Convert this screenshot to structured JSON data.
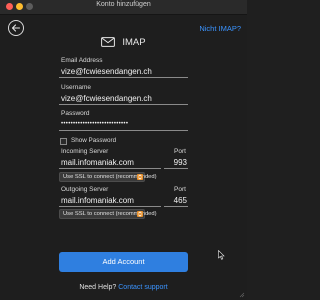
{
  "window": {
    "title": "Konto hinzufügen"
  },
  "header": {
    "alt_provider_link": "Nicht IMAP?",
    "provider": "IMAP"
  },
  "form": {
    "email_label": "Email Address",
    "email_value": "vize@fcwiesendangen.ch",
    "username_label": "Username",
    "username_value": "vize@fcwiesendangen.ch",
    "password_label": "Password",
    "password_mask": "••••••••••••••••••••••••••••",
    "show_password_label": "Show Password",
    "incoming_label": "Incoming Server",
    "incoming_port_label": "Port",
    "incoming_server": "mail.infomaniak.com",
    "incoming_port": "993",
    "incoming_ssl": "Use SSL to connect (recommended)",
    "outgoing_label": "Outgoing Server",
    "outgoing_port_label": "Port",
    "outgoing_server": "mail.infomaniak.com",
    "outgoing_port": "465",
    "outgoing_ssl": "Use SSL to connect (recommended)",
    "submit_label": "Add Account"
  },
  "footer": {
    "help_text": "Need Help?",
    "support_link": "Contact support"
  },
  "colors": {
    "accent": "#2f7fe0",
    "link": "#3b94ff",
    "background": "#1e1e1e",
    "ssl_toggle": "#e8912d"
  },
  "icons": {
    "back": "arrow-left-icon",
    "mail": "envelope-icon",
    "ssl_dropdown": "chevron-updown-icon"
  }
}
